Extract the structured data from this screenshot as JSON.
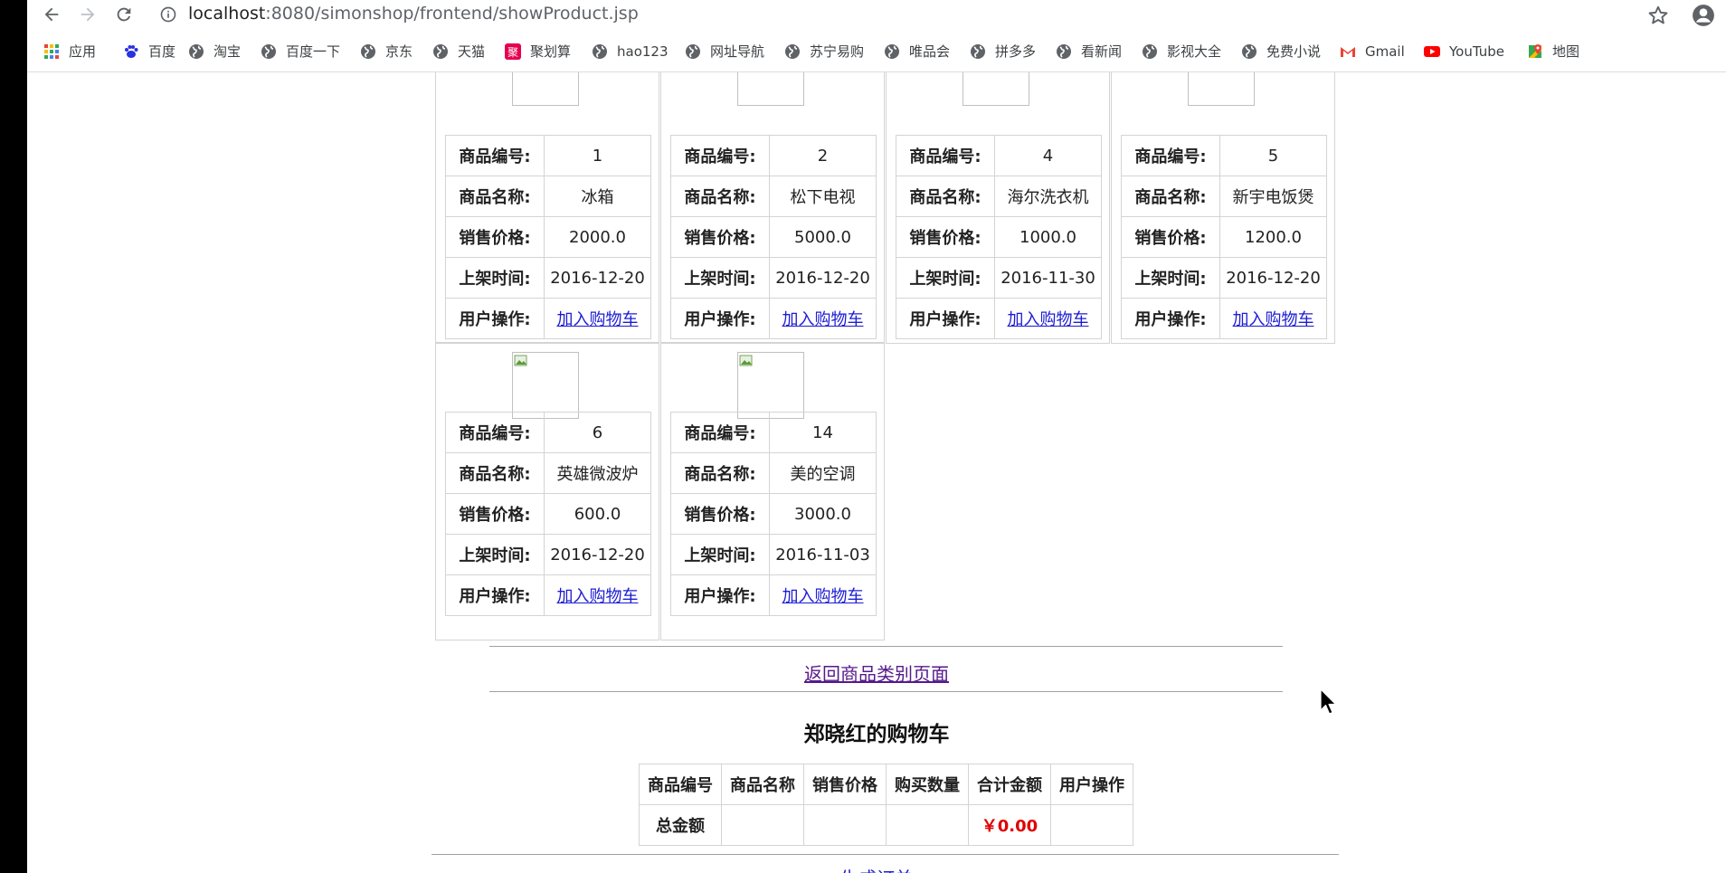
{
  "browser": {
    "url_host": "localhost",
    "url_path": ":8080/simonshop/frontend/showProduct.jsp",
    "bookmarks": [
      {
        "label": "应用",
        "icon": "apps-grid-icon"
      },
      {
        "label": "百度",
        "icon": "baidu-paw-icon"
      },
      {
        "label": "淘宝",
        "icon": "globe-icon"
      },
      {
        "label": "百度一下",
        "icon": "globe-icon"
      },
      {
        "label": "京东",
        "icon": "globe-icon"
      },
      {
        "label": "天猫",
        "icon": "globe-icon"
      },
      {
        "label": "聚划算",
        "icon": "juhuasuan-icon"
      },
      {
        "label": "hao123",
        "icon": "globe-icon"
      },
      {
        "label": "网址导航",
        "icon": "globe-icon"
      },
      {
        "label": "苏宁易购",
        "icon": "globe-icon"
      },
      {
        "label": "唯品会",
        "icon": "globe-icon"
      },
      {
        "label": "拼多多",
        "icon": "globe-icon"
      },
      {
        "label": "看新闻",
        "icon": "globe-icon"
      },
      {
        "label": "影视大全",
        "icon": "globe-icon"
      },
      {
        "label": "免费小说",
        "icon": "globe-icon"
      },
      {
        "label": "Gmail",
        "icon": "gmail-icon"
      },
      {
        "label": "YouTube",
        "icon": "youtube-icon"
      },
      {
        "label": "地图",
        "icon": "maps-icon"
      }
    ]
  },
  "labels": {
    "id": "商品编号:",
    "name": "商品名称:",
    "price": "销售价格:",
    "date": "上架时间:",
    "action": "用户操作:"
  },
  "add_to_cart": "加入购物车",
  "products": [
    {
      "id": "1",
      "name": "冰箱",
      "price": "2000.0",
      "date": "2016-12-20"
    },
    {
      "id": "2",
      "name": "松下电视",
      "price": "5000.0",
      "date": "2016-12-20"
    },
    {
      "id": "4",
      "name": "海尔洗衣机",
      "price": "1000.0",
      "date": "2016-11-30"
    },
    {
      "id": "5",
      "name": "新宇电饭煲",
      "price": "1200.0",
      "date": "2016-12-20"
    },
    {
      "id": "6",
      "name": "英雄微波炉",
      "price": "600.0",
      "date": "2016-12-20"
    },
    {
      "id": "14",
      "name": "美的空调",
      "price": "3000.0",
      "date": "2016-11-03"
    }
  ],
  "back_link": "返回商品类别页面",
  "cart": {
    "title": "郑晓红的购物车",
    "headers": [
      "商品编号",
      "商品名称",
      "销售价格",
      "购买数量",
      "合计金额",
      "用户操作"
    ],
    "total_label": "总金额",
    "total_value": "￥0.00"
  },
  "bottom_link": "生成订单"
}
